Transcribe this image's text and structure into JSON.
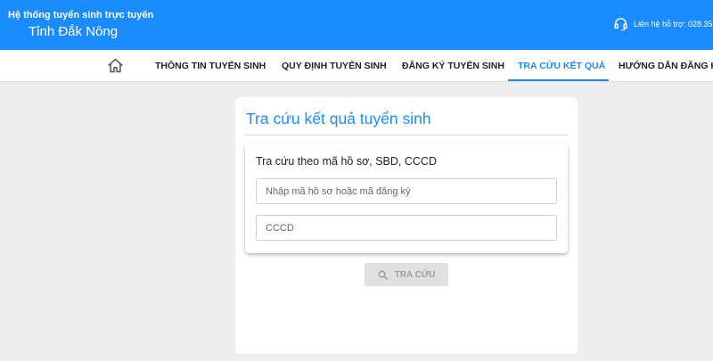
{
  "header": {
    "system_title": "Hệ thống tuyển sinh trực tuyến",
    "province": "Tỉnh Đắk Nông",
    "support_text": "Liên hệ hỗ trợ: 028.35",
    "support_icon": "headset-icon"
  },
  "nav": {
    "home_icon": "home-icon",
    "items": [
      {
        "label": "THÔNG TIN TUYỂN SINH"
      },
      {
        "label": "QUY ĐỊNH TUYỂN SINH"
      },
      {
        "label": "ĐĂNG KÝ TUYỂN SINH"
      },
      {
        "label": "TRA CỨU KẾT QUẢ",
        "active": true
      },
      {
        "label": "HƯỚNG DẪN ĐĂNG KÝ"
      }
    ]
  },
  "lookup": {
    "title": "Tra cứu kết quả tuyển sinh",
    "panel_title": "Tra cứu theo mã hồ sơ, SBD, CCCD",
    "code_placeholder": "Nhập mã hồ sơ hoặc mã đăng ký",
    "code_value": "",
    "id_placeholder": "CCCD",
    "id_value": "",
    "button_label": "TRA CỨU",
    "button_icon": "search-icon"
  },
  "colors": {
    "primary": "#1a8cff",
    "background": "#eeeeee",
    "button_disabled": "#e0e0e0"
  }
}
